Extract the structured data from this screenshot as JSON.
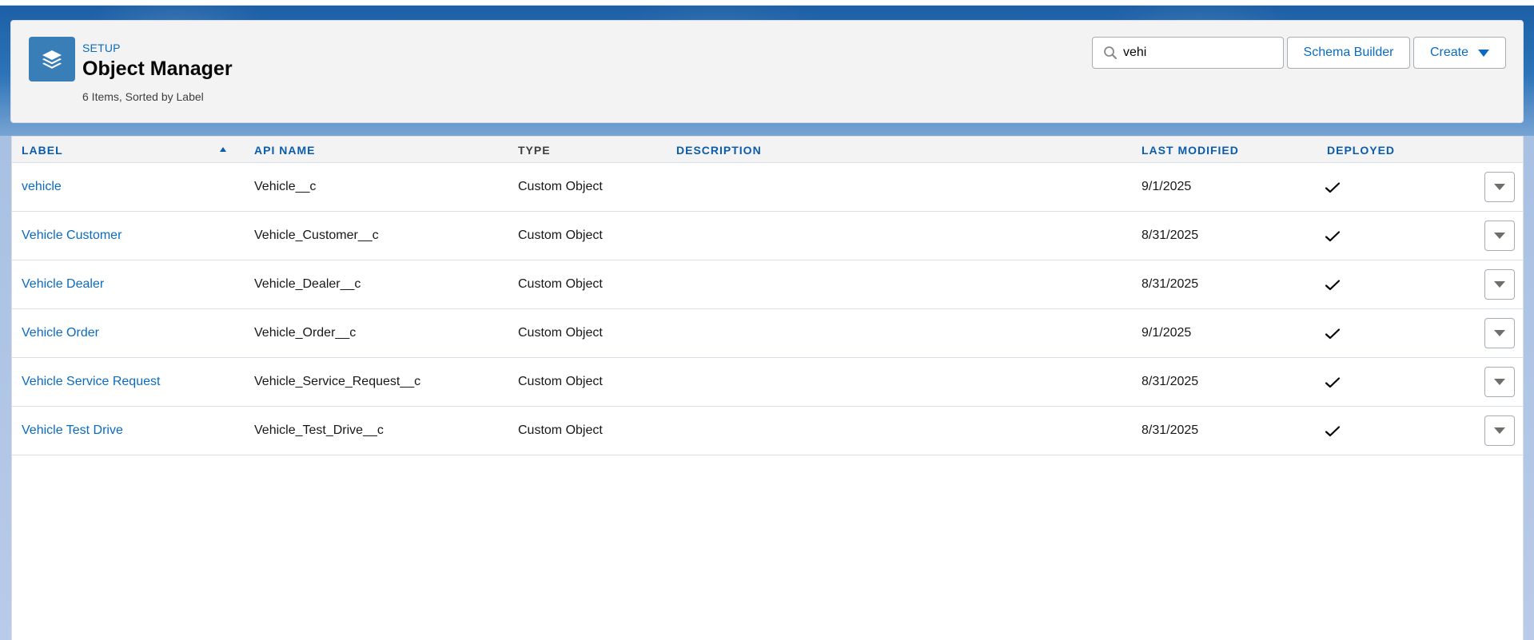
{
  "header": {
    "breadcrumb": "SETUP",
    "title": "Object Manager",
    "summary": "6 Items, Sorted by Label",
    "icon": "object-manager-layers-icon"
  },
  "search": {
    "value": "vehi",
    "icon": "search-icon"
  },
  "buttons": {
    "schema_builder": "Schema Builder",
    "create": "Create"
  },
  "table": {
    "columns": {
      "label": "LABEL",
      "api_name": "API NAME",
      "type": "TYPE",
      "description": "DESCRIPTION",
      "last_modified": "LAST MODIFIED",
      "deployed": "DEPLOYED"
    },
    "sorted_by": "label",
    "sort_direction": "ascending",
    "rows": [
      {
        "label": "vehicle",
        "api_name": "Vehicle__c",
        "type": "Custom Object",
        "description": "",
        "last_modified": "9/1/2025",
        "deployed": true
      },
      {
        "label": "Vehicle Customer",
        "api_name": "Vehicle_Customer__c",
        "type": "Custom Object",
        "description": "",
        "last_modified": "8/31/2025",
        "deployed": true
      },
      {
        "label": "Vehicle Dealer",
        "api_name": "Vehicle_Dealer__c",
        "type": "Custom Object",
        "description": "",
        "last_modified": "8/31/2025",
        "deployed": true
      },
      {
        "label": "Vehicle Order",
        "api_name": "Vehicle_Order__c",
        "type": "Custom Object",
        "description": "",
        "last_modified": "9/1/2025",
        "deployed": true
      },
      {
        "label": "Vehicle Service Request",
        "api_name": "Vehicle_Service_Request__c",
        "type": "Custom Object",
        "description": "",
        "last_modified": "8/31/2025",
        "deployed": true
      },
      {
        "label": "Vehicle Test Drive",
        "api_name": "Vehicle_Test_Drive__c",
        "type": "Custom Object",
        "description": "",
        "last_modified": "8/31/2025",
        "deployed": true
      }
    ]
  },
  "colors": {
    "brand_blue": "#0b6bbf",
    "header_link_blue": "#0b5cab",
    "icon_bg": "#3a7eb8",
    "band_blue": "#1d5fa6"
  }
}
